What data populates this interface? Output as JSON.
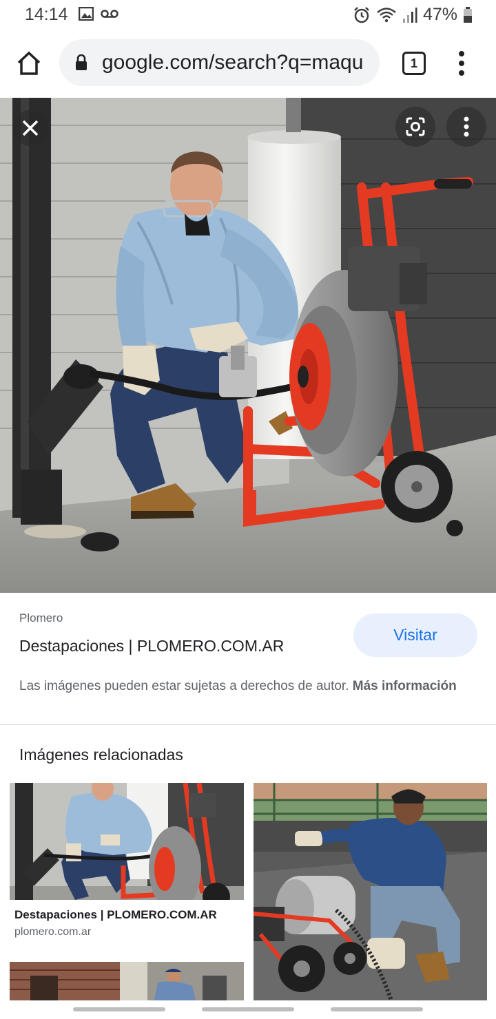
{
  "status": {
    "time": "14:14",
    "battery": "47%"
  },
  "browser": {
    "url": "google.com/search?q=maqu",
    "tab_count": "1"
  },
  "result": {
    "source": "Plomero",
    "title": "Destapaciones | PLOMERO.COM.AR",
    "visit_label": "Visitar",
    "copyright_text": "Las imágenes pueden estar sujetas a derechos de autor. ",
    "more_info_label": "Más información"
  },
  "related": {
    "heading": "Imágenes relacionadas",
    "items": [
      {
        "title": "Destapaciones | PLOMERO.COM.AR",
        "domain": "plomero.com.ar"
      }
    ]
  },
  "colors": {
    "accent": "#1a73e8",
    "visit_bg": "#e8f0fe",
    "machine_red": "#e53a22"
  },
  "icons": [
    "image-icon",
    "voicemail-icon",
    "alarm-icon",
    "wifi-icon",
    "signal-icon",
    "battery-icon",
    "home-icon",
    "lock-icon",
    "tabs-icon",
    "more-vert-icon",
    "close-icon",
    "lens-icon"
  ]
}
